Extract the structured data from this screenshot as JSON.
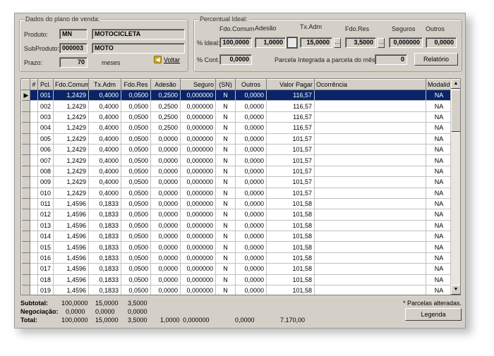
{
  "plano": {
    "legend": "Dados do plano de venda:",
    "produto_label": "Produto:",
    "produto_code": "MN",
    "produto_name": "MOTOCICLETA",
    "subproduto_label": "SubProduto:",
    "subproduto_code": "000003",
    "subproduto_name": "MOTO",
    "prazo_label": "Prazo:",
    "prazo_value": "70",
    "prazo_unit": "meses",
    "voltar_label": "Voltar"
  },
  "percentual": {
    "legend": "Percentual Ideal:",
    "col_labels": [
      "Fdo.Comum",
      "Adesão",
      "Tx.Adm",
      "Fdo.Res",
      "Seguros",
      "Outros"
    ],
    "ideal_label": "% Ideal:",
    "ideal_values": [
      "100,0000",
      "1,0000",
      "15,0000",
      "3,5000",
      "0,000000",
      "0,0000"
    ],
    "cont_label": "% Cont.:",
    "cont_value": "0,0000",
    "parcela_label": "Parcela Integrada a parcela do mês:",
    "parcela_value": "0",
    "relatorio_label": "Relatório"
  },
  "grid": {
    "headers": [
      "#",
      "Pcl.",
      "Fdo.Comum",
      "Tx.Adm",
      "Fdo.Res",
      "Adesão",
      "Seguro",
      "(SN)",
      "Outros",
      "Valor Pagar",
      "Ocorrência",
      "Modalid."
    ],
    "rows": [
      [
        "001",
        "1,2429",
        "0,4000",
        "0,0500",
        "0,2500",
        "0,000000",
        "N",
        "0,0000",
        "116,57",
        "",
        "NA"
      ],
      [
        "002",
        "1,2429",
        "0,4000",
        "0,0500",
        "0,2500",
        "0,000000",
        "N",
        "0,0000",
        "116,57",
        "",
        "NA"
      ],
      [
        "003",
        "1,2429",
        "0,4000",
        "0,0500",
        "0,2500",
        "0,000000",
        "N",
        "0,0000",
        "116,57",
        "",
        "NA"
      ],
      [
        "004",
        "1,2429",
        "0,4000",
        "0,0500",
        "0,2500",
        "0,000000",
        "N",
        "0,0000",
        "116,57",
        "",
        "NA"
      ],
      [
        "005",
        "1,2429",
        "0,4000",
        "0,0500",
        "0,0000",
        "0,000000",
        "N",
        "0,0000",
        "101,57",
        "",
        "NA"
      ],
      [
        "006",
        "1,2429",
        "0,4000",
        "0,0500",
        "0,0000",
        "0,000000",
        "N",
        "0,0000",
        "101,57",
        "",
        "NA"
      ],
      [
        "007",
        "1,2429",
        "0,4000",
        "0,0500",
        "0,0000",
        "0,000000",
        "N",
        "0,0000",
        "101,57",
        "",
        "NA"
      ],
      [
        "008",
        "1,2429",
        "0,4000",
        "0,0500",
        "0,0000",
        "0,000000",
        "N",
        "0,0000",
        "101,57",
        "",
        "NA"
      ],
      [
        "009",
        "1,2429",
        "0,4000",
        "0,0500",
        "0,0000",
        "0,000000",
        "N",
        "0,0000",
        "101,57",
        "",
        "NA"
      ],
      [
        "010",
        "1,2429",
        "0,4000",
        "0,0500",
        "0,0000",
        "0,000000",
        "N",
        "0,0000",
        "101,57",
        "",
        "NA"
      ],
      [
        "011",
        "1,4596",
        "0,1833",
        "0,0500",
        "0,0000",
        "0,000000",
        "N",
        "0,0000",
        "101,58",
        "",
        "NA"
      ],
      [
        "012",
        "1,4596",
        "0,1833",
        "0,0500",
        "0,0000",
        "0,000000",
        "N",
        "0,0000",
        "101,58",
        "",
        "NA"
      ],
      [
        "013",
        "1,4596",
        "0,1833",
        "0,0500",
        "0,0000",
        "0,000000",
        "N",
        "0,0000",
        "101,58",
        "",
        "NA"
      ],
      [
        "014",
        "1,4596",
        "0,1833",
        "0,0500",
        "0,0000",
        "0,000000",
        "N",
        "0,0000",
        "101,58",
        "",
        "NA"
      ],
      [
        "015",
        "1,4596",
        "0,1833",
        "0,0500",
        "0,0000",
        "0,000000",
        "N",
        "0,0000",
        "101,58",
        "",
        "NA"
      ],
      [
        "016",
        "1,4596",
        "0,1833",
        "0,0500",
        "0,0000",
        "0,000000",
        "N",
        "0,0000",
        "101,58",
        "",
        "NA"
      ],
      [
        "017",
        "1,4596",
        "0,1833",
        "0,0500",
        "0,0000",
        "0,000000",
        "N",
        "0,0000",
        "101,58",
        "",
        "NA"
      ],
      [
        "018",
        "1,4596",
        "0,1833",
        "0,0500",
        "0,0000",
        "0,000000",
        "N",
        "0,0000",
        "101,58",
        "",
        "NA"
      ],
      [
        "019",
        "1,4596",
        "0,1833",
        "0,0500",
        "0,0000",
        "0,000000",
        "N",
        "0,0000",
        "101,58",
        "",
        "NA"
      ]
    ],
    "selected_row": 0
  },
  "totals": {
    "subtotal": {
      "label": "Subtotal:",
      "values": [
        "100,0000",
        "15,0000",
        "3,5000"
      ]
    },
    "negociacao": {
      "label": "Negociação:",
      "values": [
        "0,0000",
        "0,0000",
        "0,0000"
      ]
    },
    "total": {
      "label": "Total:",
      "values": [
        "100,0000",
        "15,0000",
        "3,5000",
        "1,0000",
        "0,000000",
        "0,0000",
        "7.170,00"
      ]
    },
    "note": "* Parcelas alteradas.",
    "legenda_label": "Legenda"
  },
  "colors": {
    "window_bg": "#d4d0c8",
    "selection": "#0a246a",
    "legend_icon": "#c8a830"
  }
}
